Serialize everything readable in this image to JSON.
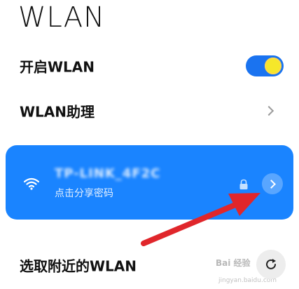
{
  "page": {
    "title": "WLAN"
  },
  "settings": {
    "wlan_toggle": {
      "label": "开启WLAN",
      "state": "on",
      "accent_color": "#1a73f0"
    },
    "assistant": {
      "label": "WLAN助理"
    },
    "connected_network": {
      "name": "TP-LINK_4F2C",
      "status": "点击分享密码",
      "card_color": "#1a84ff"
    },
    "nearby": {
      "label": "选取附近的WLAN"
    }
  },
  "watermark": {
    "text": "Bai 经验",
    "sub": "jingyan.baidu.com"
  },
  "icons": {
    "wifi": "wifi-icon",
    "lock": "lock-icon",
    "detail": "chevron-right-icon",
    "refresh": "refresh-icon"
  }
}
